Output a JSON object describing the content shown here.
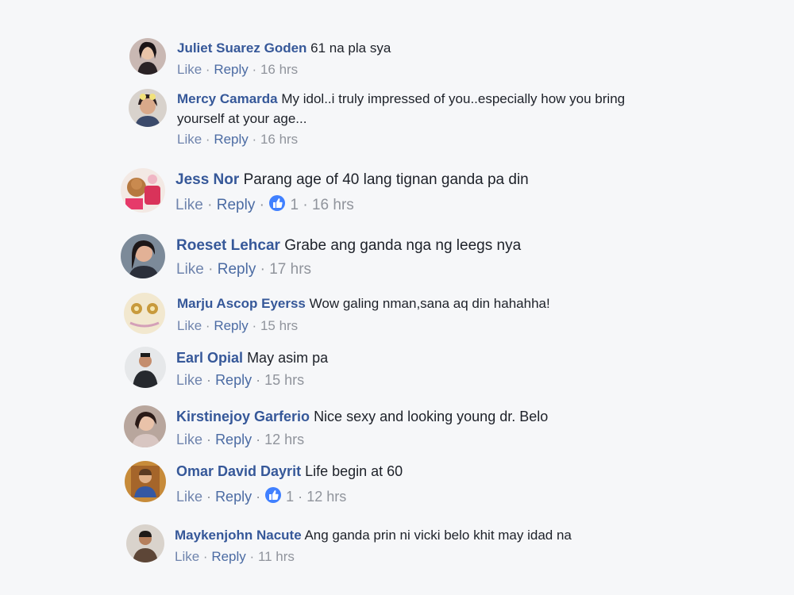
{
  "like_label": "Like",
  "reply_label": "Reply",
  "separator": "·",
  "reaction_icon": "thumbs-up-icon",
  "colors": {
    "name": "#365899",
    "text": "#1d2129",
    "meta": "#90949c",
    "reaction": "#4080ff",
    "background": "#f6f7f9"
  },
  "comments": [
    {
      "name": "Juliet Suarez Goden",
      "text": "61 na pla sya",
      "text_cont": "",
      "reactions": "",
      "time": "16 hrs"
    },
    {
      "name": "Mercy Camarda",
      "text": "My idol..i truly impressed of you..especially how you bring",
      "text_cont": "yourself at your age...",
      "reactions": "",
      "time": "16 hrs"
    },
    {
      "name": "Jess Nor",
      "text": "Parang age of 40 lang tignan ganda pa din",
      "text_cont": "",
      "reactions": "1",
      "time": "16 hrs"
    },
    {
      "name": "Roeset Lehcar",
      "text": "Grabe ang ganda nga ng leegs nya",
      "text_cont": "",
      "reactions": "",
      "time": "17 hrs"
    },
    {
      "name": "Marju Ascop Eyerss",
      "text": "Wow galing nman,sana aq din hahahha!",
      "text_cont": "",
      "reactions": "",
      "time": "15 hrs"
    },
    {
      "name": "Earl Opial",
      "text": "May asim pa",
      "text_cont": "",
      "reactions": "",
      "time": "15 hrs"
    },
    {
      "name": "Kirstinejoy Garferio",
      "text": "Nice sexy and looking young dr. Belo",
      "text_cont": "",
      "reactions": "",
      "time": "12 hrs"
    },
    {
      "name": "Omar David Dayrit",
      "text": "Life begin at 60",
      "text_cont": "",
      "reactions": "1",
      "time": "12 hrs"
    },
    {
      "name": "Maykenjohn Nacute",
      "text": "Ang ganda prin ni vicki belo khit may idad na",
      "text_cont": "",
      "reactions": "",
      "time": "11 hrs"
    }
  ]
}
